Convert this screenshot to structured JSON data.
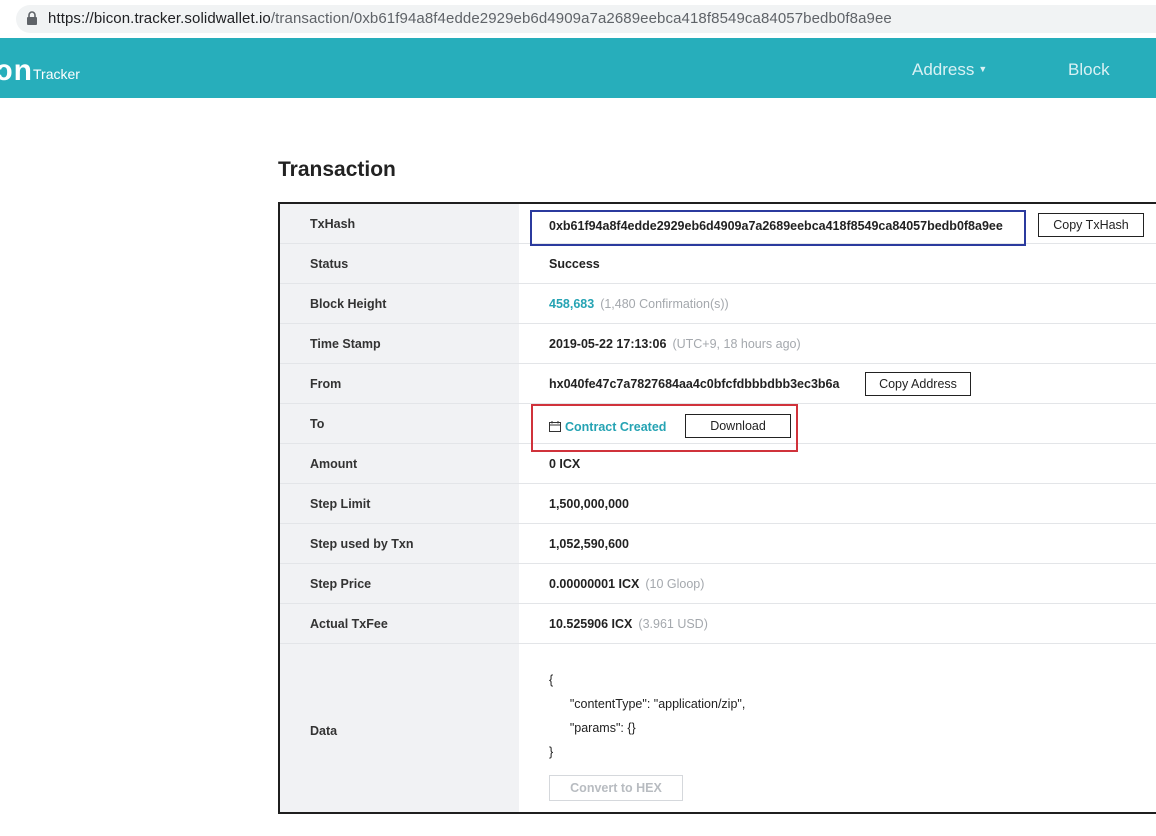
{
  "browser": {
    "url_host": "https://bicon.tracker.solidwallet.io",
    "url_path": "/transaction/0xb61f94a8f4edde2929eb6d4909a7a2689eebca418f8549ca84057bedb0f8a9ee"
  },
  "header": {
    "logo_mark": "ɔn",
    "logo_sub": "Tracker",
    "nav_address": "Address",
    "nav_block": "Block",
    "accent_color": "#27aebb"
  },
  "page": {
    "title": "Transaction"
  },
  "rows": {
    "txhash": {
      "label": "TxHash",
      "value": "0xb61f94a8f4edde2929eb6d4909a7a2689eebca418f8549ca84057bedb0f8a9ee",
      "copy_btn": "Copy TxHash"
    },
    "status": {
      "label": "Status",
      "value": "Success"
    },
    "block_height": {
      "label": "Block Height",
      "value": "458,683",
      "note": "(1,480 Confirmation(s))"
    },
    "time_stamp": {
      "label": "Time Stamp",
      "value": "2019-05-22 17:13:06",
      "note": "(UTC+9, 18 hours ago)"
    },
    "from": {
      "label": "From",
      "value": "hx040fe47c7a7827684aa4c0bfcfdbbbdbb3ec3b6a",
      "copy_btn": "Copy Address"
    },
    "to": {
      "label": "To",
      "value": "Contract Created",
      "download_btn": "Download"
    },
    "amount": {
      "label": "Amount",
      "value": "0 ICX"
    },
    "step_limit": {
      "label": "Step Limit",
      "value": "1,500,000,000"
    },
    "step_used": {
      "label": "Step used by Txn",
      "value": "1,052,590,600"
    },
    "step_price": {
      "label": "Step Price",
      "value": "0.00000001 ICX",
      "note": "(10 Gloop)"
    },
    "actual_fee": {
      "label": "Actual TxFee",
      "value": "10.525906 ICX",
      "note": "(3.961 USD)"
    },
    "data": {
      "label": "Data",
      "json": "{\n      \"contentType\": \"application/zip\",\n      \"params\": {}\n}",
      "convert_btn": "Convert to HEX"
    }
  }
}
